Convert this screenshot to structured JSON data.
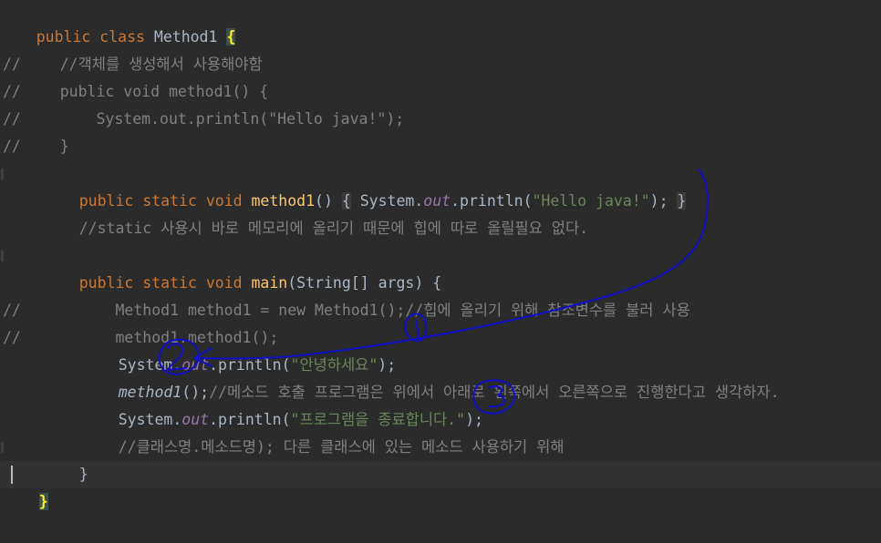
{
  "gutter": {
    "comment_mark": "//"
  },
  "code_lines": {
    "l1": {
      "kw": "public class ",
      "name": "Method1 ",
      "brace": "{"
    },
    "l2": {
      "text": "    //객체를 생성해서 사용해야함"
    },
    "l3": {
      "text": "    public void method1() {"
    },
    "l4": {
      "text": "        System.out.println(\"Hello java!\");"
    },
    "l5": {
      "text": "    }"
    },
    "l6": {
      "kw": "public static void ",
      "fn": "method1",
      "p1": "() ",
      "b1": "{",
      "p2": " System.",
      "out": "out",
      "p3": ".println(",
      "str": "\"Hello java!\"",
      "p4": "); ",
      "b2": "}"
    },
    "l7": {
      "text": "//static 사용시 바로 메모리에 올리기 때문에 힙에 따로 올릴필요 없다."
    },
    "l8": {
      "kw": "public static void ",
      "fn": "main",
      "rest": "(String[] args) {"
    },
    "l9": {
      "text": "        Method1 method1 = new Method1();//힙에 올리기 위해 참조변수를 불러 사용"
    },
    "l10": {
      "text": "        method1.method1();"
    },
    "l11": {
      "p1": "System.",
      "out": "out",
      "p2": ".println(",
      "str": "\"안녕하세요\"",
      "p3": ");"
    },
    "l12": {
      "call": "method1",
      "p1": "();",
      "cm": "//메소드 호출 프로그램은 위에서 아래로 왼쪽에서 오른쪽으로 진행한다고 생각하자."
    },
    "l13": {
      "p1": "System.",
      "out": "out",
      "p2": ".println(",
      "str": "\"프로그램을 종료합니다.\"",
      "p3": ");"
    },
    "l14": {
      "text": "//클래스명.메소드명); 다른 클래스에 있는 메소드 사용하기 위해"
    },
    "l15": {
      "text": "}"
    },
    "l16": {
      "text": "}"
    }
  },
  "annotations": {
    "ink_color": "#1010c8",
    "marks": [
      {
        "label": "1",
        "meaning": "first println"
      },
      {
        "label": "2",
        "meaning": "method1 call"
      },
      {
        "label": "3",
        "meaning": "last println"
      }
    ]
  }
}
